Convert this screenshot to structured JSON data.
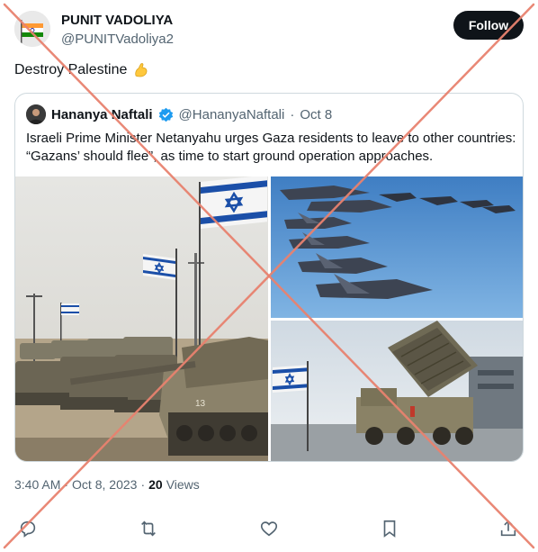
{
  "post": {
    "author_name": "PUNIT VADOLIYA",
    "author_handle": "@PUNITVadoliya2",
    "follow_label": "Follow",
    "text": "Destroy Palestine",
    "emoji_icon": "flexed-biceps-icon"
  },
  "quoted": {
    "author_name": "Hananya Naftali",
    "author_handle": "@HananyaNaftali",
    "separator": "·",
    "date": "Oct 8",
    "text": "Israeli Prime Minister Netanyahu urges Gaza residents to leave to other countries: “Gazans’ should flee”, as time to start ground operation approaches.",
    "verified_icon": "verified-badge-icon",
    "verified_color": "#1d9bf0"
  },
  "meta": {
    "time": "3:40 AM",
    "separator": "·",
    "date": "Oct 8, 2023",
    "separator2": "·",
    "views_count": "20",
    "views_label": "Views"
  },
  "actions": [
    {
      "name": "reply",
      "icon": "reply-icon"
    },
    {
      "name": "retweet",
      "icon": "retweet-icon"
    },
    {
      "name": "like",
      "icon": "heart-icon"
    },
    {
      "name": "bookmark",
      "icon": "bookmark-icon"
    },
    {
      "name": "share",
      "icon": "share-icon"
    }
  ],
  "overlay": {
    "cross_color": "#e8826f",
    "icon": "fact-check-cross-overlay"
  }
}
